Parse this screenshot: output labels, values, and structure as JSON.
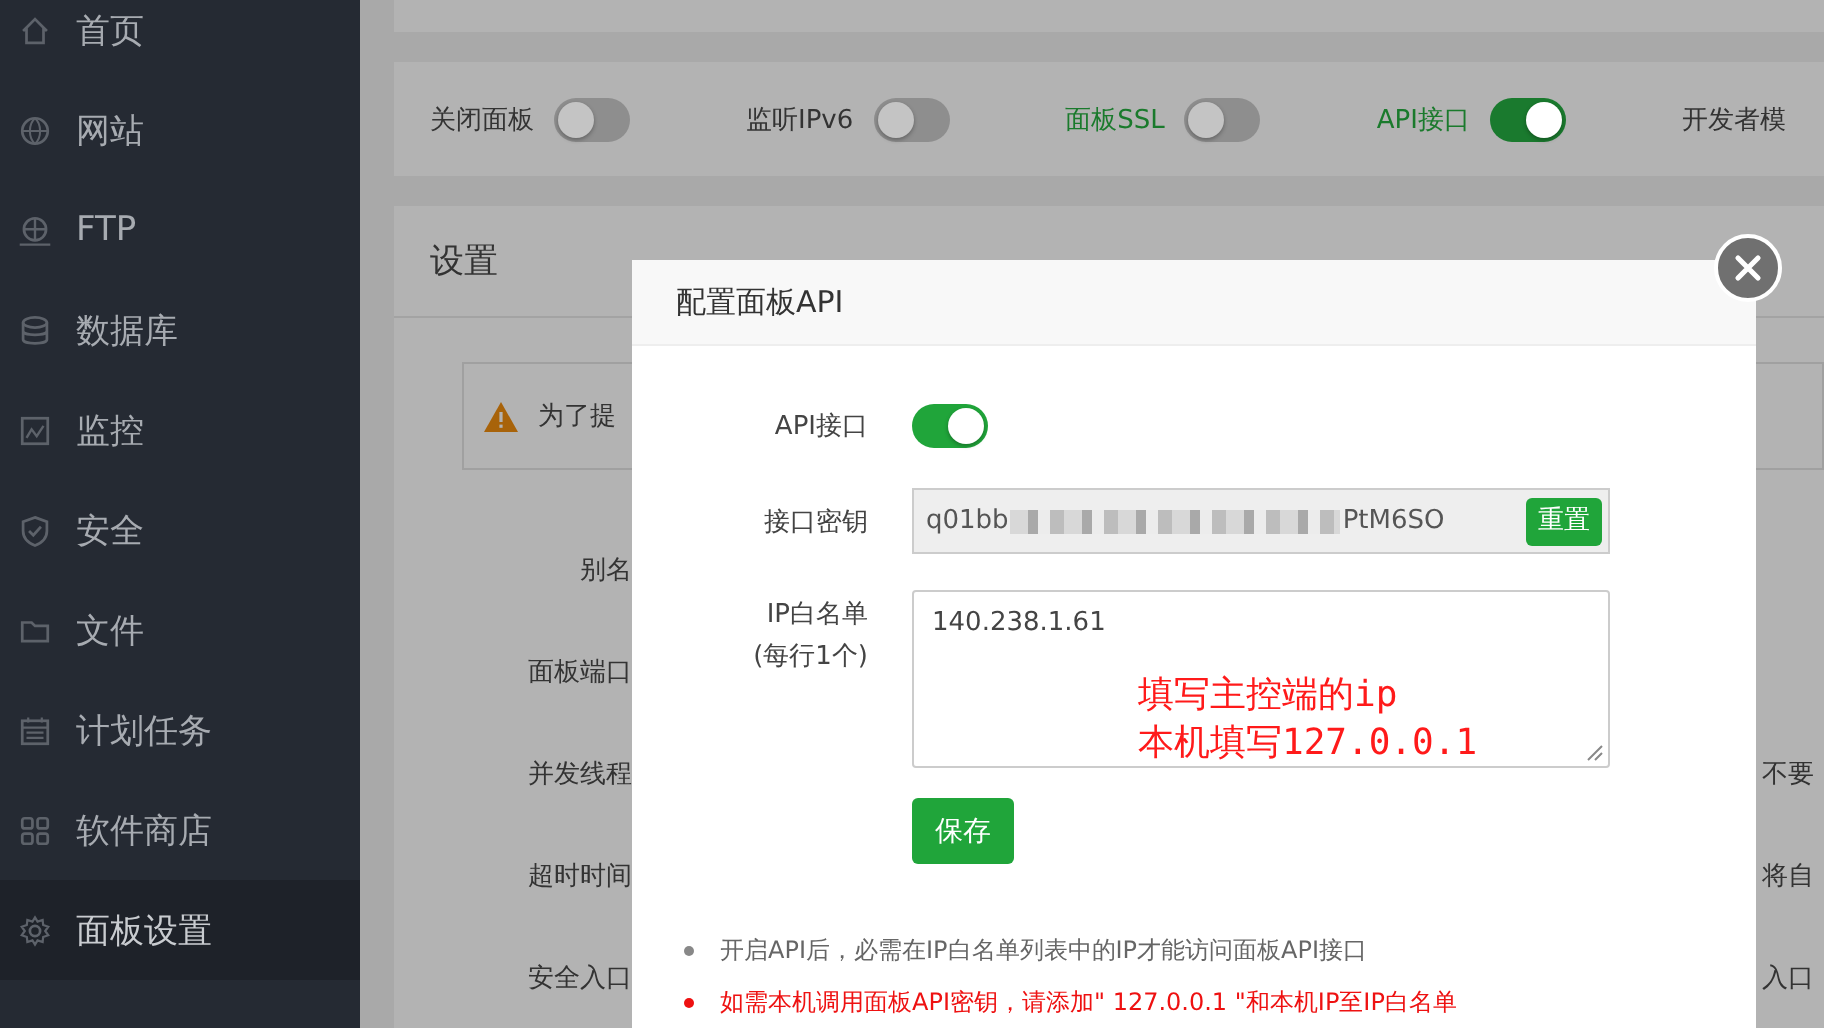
{
  "sidebar": {
    "items": [
      {
        "label": "首页",
        "selected": false
      },
      {
        "label": "网站",
        "selected": false
      },
      {
        "label": "FTP",
        "selected": false
      },
      {
        "label": "数据库",
        "selected": false
      },
      {
        "label": "监控",
        "selected": false
      },
      {
        "label": "安全",
        "selected": false
      },
      {
        "label": "文件",
        "selected": false
      },
      {
        "label": "计划任务",
        "selected": false
      },
      {
        "label": "软件商店",
        "selected": false
      },
      {
        "label": "面板设置",
        "selected": true
      }
    ]
  },
  "switch_bar": {
    "switches": [
      {
        "label": "关闭面板",
        "on": false,
        "highlighted": false
      },
      {
        "label": "监听IPv6",
        "on": false,
        "highlighted": false
      },
      {
        "label": "面板SSL",
        "on": false,
        "highlighted": true
      },
      {
        "label": "API接口",
        "on": true,
        "highlighted": true
      }
    ],
    "cut_label": "开发者模"
  },
  "settings": {
    "title": "设置",
    "notice": "为了提",
    "rows": [
      {
        "label": "别名"
      },
      {
        "label": "面板端口"
      },
      {
        "label": "并发线程",
        "note": "不要"
      },
      {
        "label": "超时时间",
        "note": "将自"
      },
      {
        "label": "安全入口",
        "note": "入口"
      }
    ]
  },
  "modal": {
    "title": "配置面板API",
    "api_switch": {
      "label": "API接口",
      "on": true
    },
    "key": {
      "label": "接口密钥",
      "prefix": "q01bb",
      "suffix": "PtM6SO",
      "button": "重置"
    },
    "whitelist": {
      "label": "IP白名单",
      "hint": "(每行1个)",
      "value": "140.238.1.61"
    },
    "save": "保存",
    "annotation": [
      "填写主控端的ip",
      "本机填写127.0.0.1"
    ],
    "notes": [
      {
        "text": "开启API后，必需在IP白名单列表中的IP才能访问面板API接口",
        "kind": "info"
      },
      {
        "text": "如需本机调用面板API密钥，请添加\" 127.0.0.1 \"和本机IP至IP白名单",
        "kind": "warning"
      }
    ]
  }
}
